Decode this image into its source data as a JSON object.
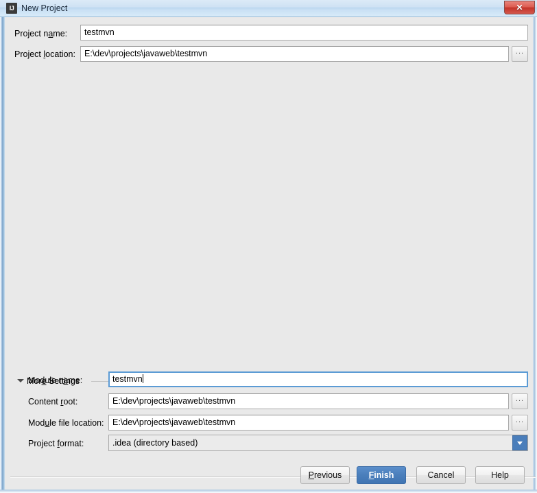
{
  "window": {
    "title": "New Project",
    "app_icon_text": "IJ",
    "close_label": "✕"
  },
  "form": {
    "project_name": {
      "label_pre": "Project n",
      "label_mnemonic": "a",
      "label_post": "me:",
      "value": "testmvn"
    },
    "project_location": {
      "label_pre": "Project ",
      "label_mnemonic": "l",
      "label_post": "ocation:",
      "value": "E:\\dev\\projects\\javaweb\\testmvn",
      "browse_label": "..."
    }
  },
  "more_settings": {
    "label_pre": "Mor",
    "label_mnemonic": "e",
    "label_post": " Settings",
    "expanded": true,
    "module_name": {
      "label_pre": "Module n",
      "label_mnemonic": "a",
      "label_post": "me:",
      "value": "testmvn",
      "focused": true
    },
    "content_root": {
      "label_pre": "Content ",
      "label_mnemonic": "r",
      "label_post": "oot:",
      "value": "E:\\dev\\projects\\javaweb\\testmvn",
      "browse_label": "..."
    },
    "module_file_location": {
      "label_pre": "Mod",
      "label_mnemonic": "u",
      "label_post": "le file location:",
      "value": "E:\\dev\\projects\\javaweb\\testmvn",
      "browse_label": "..."
    },
    "project_format": {
      "label_pre": "Project ",
      "label_mnemonic": "f",
      "label_post": "ormat:",
      "selected": ".idea (directory based)"
    }
  },
  "buttons": {
    "previous": {
      "pre": "",
      "mnemonic": "P",
      "post": "revious"
    },
    "finish": {
      "pre": "",
      "mnemonic": "F",
      "post": "inish"
    },
    "cancel": {
      "pre": "Cancel",
      "mnemonic": "",
      "post": ""
    },
    "help": {
      "pre": "Help",
      "mnemonic": "",
      "post": ""
    }
  },
  "colors": {
    "accent_blue": "#4a7ebb",
    "focus_blue": "#5b9bd5",
    "dialog_bg": "#e9e9e9",
    "close_red": "#c3342a"
  }
}
